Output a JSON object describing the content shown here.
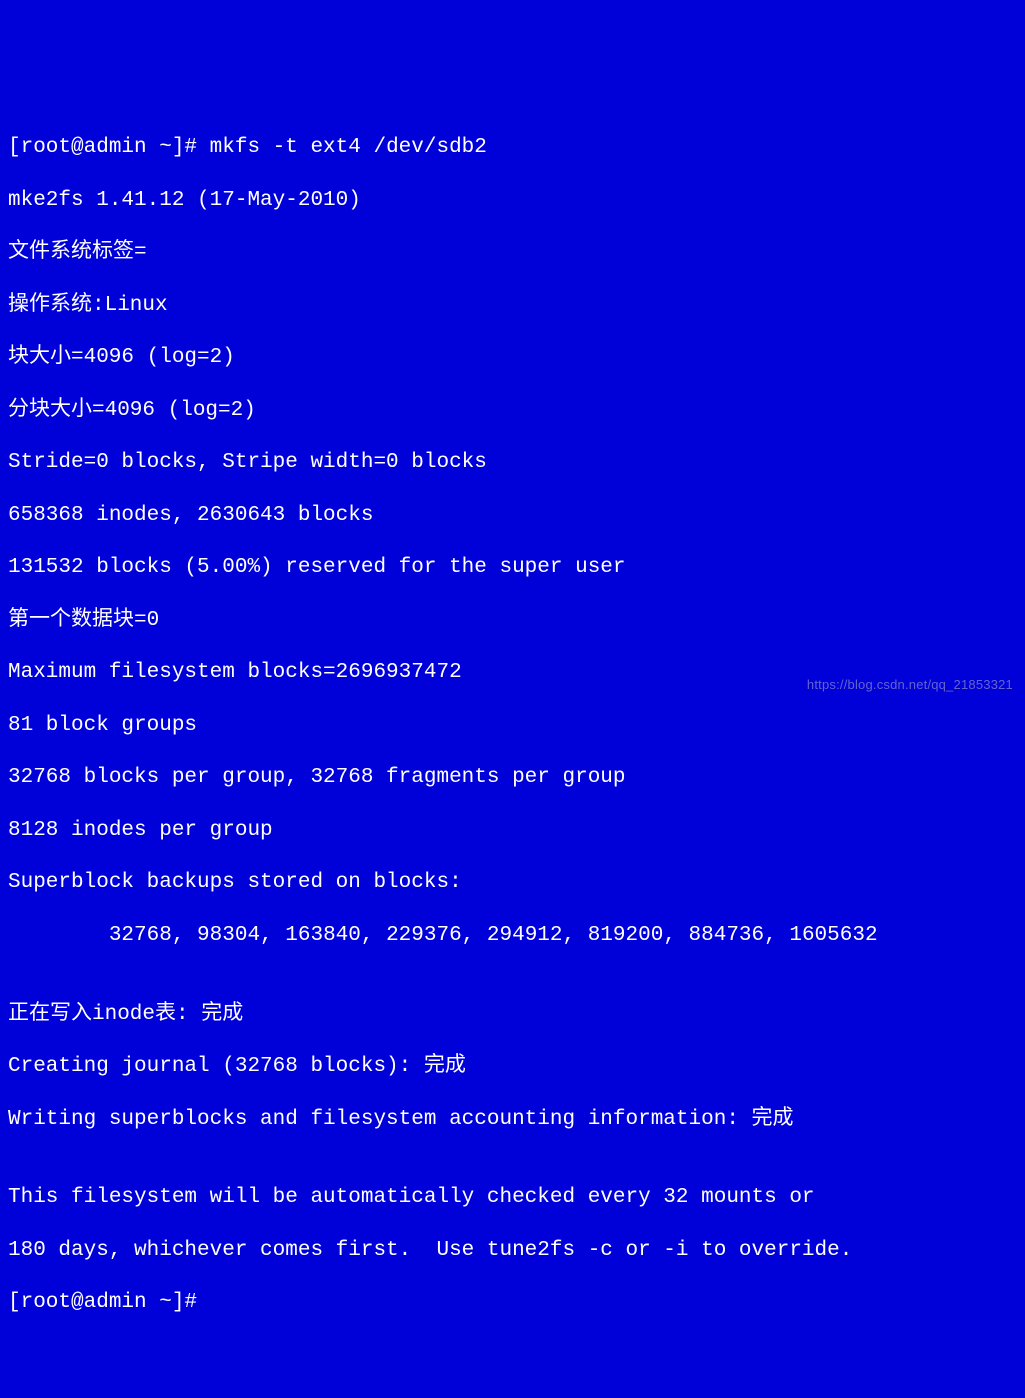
{
  "terminal": {
    "prompt1": "[root@admin ~]# ",
    "command": "mkfs -t ext4 /dev/sdb2",
    "lines": [
      "mke2fs 1.41.12 (17-May-2010)",
      "文件系统标签=",
      "操作系统:Linux",
      "块大小=4096 (log=2)",
      "分块大小=4096 (log=2)",
      "Stride=0 blocks, Stripe width=0 blocks",
      "658368 inodes, 2630643 blocks",
      "131532 blocks (5.00%) reserved for the super user",
      "第一个数据块=0",
      "Maximum filesystem blocks=2696937472",
      "81 block groups",
      "32768 blocks per group, 32768 fragments per group",
      "8128 inodes per group",
      "Superblock backups stored on blocks: ",
      "        32768, 98304, 163840, 229376, 294912, 819200, 884736, 1605632",
      "",
      "正在写入inode表: 完成",
      "Creating journal (32768 blocks): 完成",
      "Writing superblocks and filesystem accounting information: 完成",
      "",
      "This filesystem will be automatically checked every 32 mounts or",
      "180 days, whichever comes first.  Use tune2fs -c or -i to override."
    ],
    "prompt2": "[root@admin ~]# "
  },
  "watermark": "https://blog.csdn.net/qq_21853321"
}
